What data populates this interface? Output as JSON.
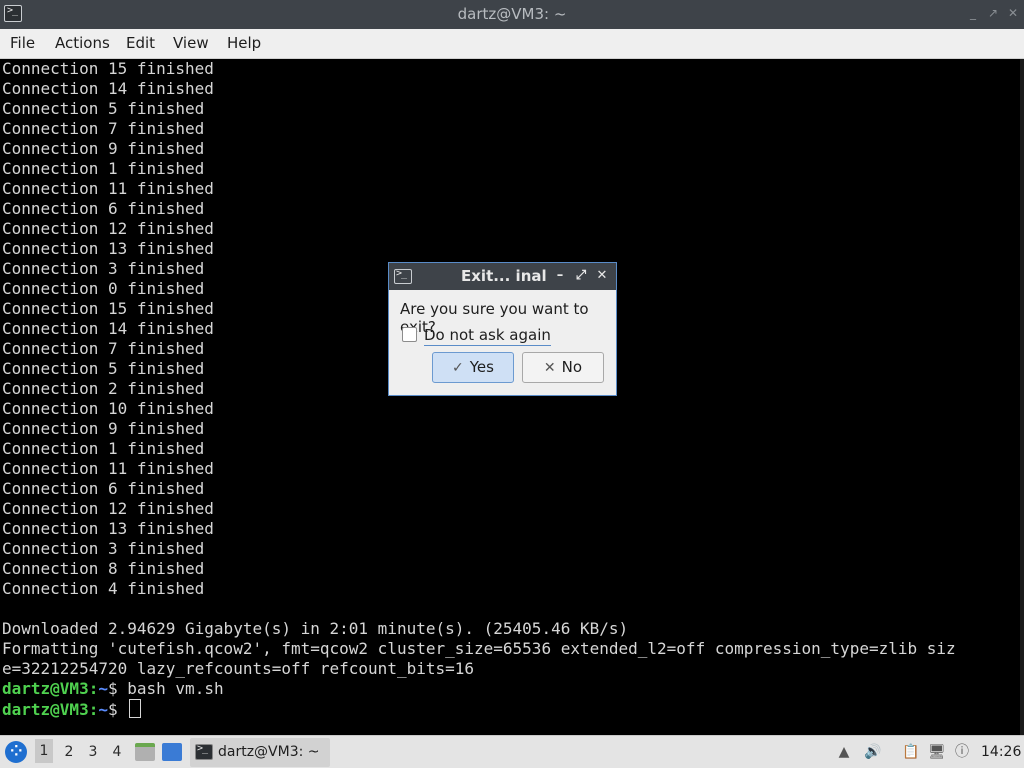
{
  "window": {
    "title": "dartz@VM3: ~",
    "icon": "terminal-icon",
    "controls": [
      "minimize-icon",
      "maximize-icon",
      "close-icon"
    ]
  },
  "menubar": [
    "File",
    "Actions",
    "Edit",
    "View",
    "Help"
  ],
  "terminal": {
    "lines": [
      "Connection 15 finished",
      "Connection 14 finished",
      "Connection 5 finished",
      "Connection 7 finished",
      "Connection 9 finished",
      "Connection 1 finished",
      "Connection 11 finished",
      "Connection 6 finished",
      "Connection 12 finished",
      "Connection 13 finished",
      "Connection 3 finished",
      "Connection 0 finished",
      "Connection 15 finished",
      "Connection 14 finished",
      "Connection 7 finished",
      "Connection 5 finished",
      "Connection 2 finished",
      "Connection 10 finished",
      "Connection 9 finished",
      "Connection 1 finished",
      "Connection 11 finished",
      "Connection 6 finished",
      "Connection 12 finished",
      "Connection 13 finished",
      "Connection 3 finished",
      "Connection 8 finished",
      "Connection 4 finished",
      "",
      "Downloaded 2.94629 Gigabyte(s) in 2:01 minute(s). (25405.46 KB/s)",
      "Formatting 'cutefish.qcow2', fmt=qcow2 cluster_size=65536 extended_l2=off compression_type=zlib siz",
      "e=32212254720 lazy_refcounts=off refcount_bits=16"
    ],
    "prompt_user": "dartz@VM3",
    "prompt_sep": ":",
    "prompt_path": "~",
    "prompt_symbol": "$",
    "prompt_lines": [
      {
        "command": " bash vm.sh"
      },
      {
        "command": " "
      }
    ]
  },
  "dialog": {
    "title": "Exit... inal",
    "question": "Are you sure you want to exit?",
    "checkbox_label": "Do not ask again",
    "checkbox_checked": false,
    "yes_label": "Yes",
    "no_label": "No"
  },
  "taskbar": {
    "workspaces": [
      "1",
      "2",
      "3",
      "4"
    ],
    "active_workspace": "1",
    "task_label": "dartz@VM3: ~",
    "clock": "14:26",
    "tray_icons": [
      "scroll-up-icon",
      "volume-icon",
      "clipboard-icon",
      "network-icon",
      "updates-icon"
    ]
  }
}
